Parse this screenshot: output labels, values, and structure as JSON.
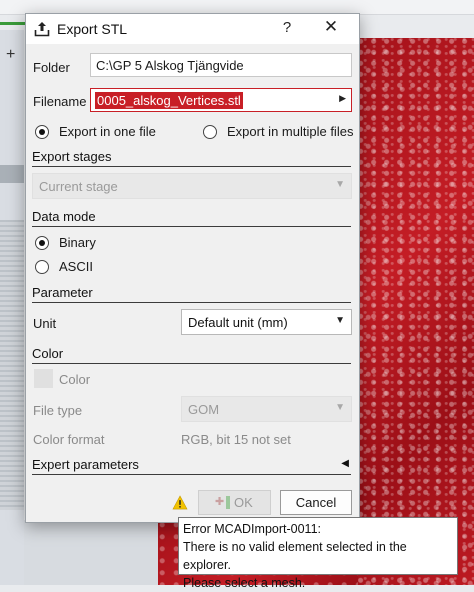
{
  "dialog": {
    "title": "Export STL",
    "help": "?",
    "close": "✕"
  },
  "folder": {
    "label": "Folder",
    "value": "C:\\GP 5 Alskog Tjängvide"
  },
  "filename": {
    "label": "Filename",
    "value": "0005_alskog_Vertices.stl"
  },
  "export_mode": {
    "one_file": "Export in one file",
    "multiple_files": "Export in multiple files",
    "selected": "one_file"
  },
  "export_stages": {
    "heading": "Export stages",
    "value": "Current stage"
  },
  "data_mode": {
    "heading": "Data mode",
    "binary": "Binary",
    "ascii": "ASCII",
    "selected": "binary"
  },
  "parameter": {
    "heading": "Parameter",
    "unit_label": "Unit",
    "unit_value": "Default unit (mm)"
  },
  "color": {
    "heading": "Color",
    "checkbox_label": "Color",
    "file_type_label": "File type",
    "file_type_value": "GOM",
    "color_format_label": "Color format",
    "color_format_value": "RGB, bit 15 not set"
  },
  "expert": {
    "heading": "Expert parameters"
  },
  "buttons": {
    "ok": "OK",
    "cancel": "Cancel"
  },
  "tooltip": {
    "line1": "Error MCADImport-0011:",
    "line2": "There is no valid element selected in the explorer.",
    "line3": "Please select a mesh."
  },
  "colors": {
    "selection_bg": "#c81f26",
    "viewport_red": "#b8161e",
    "warning": "#f2c200"
  }
}
